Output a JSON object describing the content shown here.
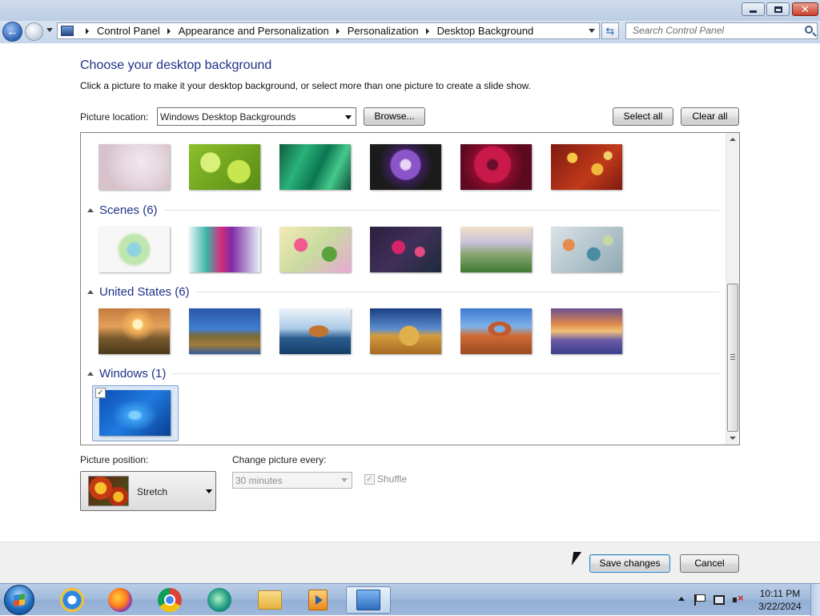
{
  "window": {
    "breadcrumb": [
      "Control Panel",
      "Appearance and Personalization",
      "Personalization",
      "Desktop Background"
    ],
    "search_placeholder": "Search Control Panel",
    "title_icons": {
      "minimize": "minimize-icon",
      "maximize": "restore-icon",
      "close": "close-icon"
    }
  },
  "page": {
    "heading": "Choose your desktop background",
    "subheading": "Click a picture to make it your desktop background, or select more than one picture to create a slide show."
  },
  "toolbar": {
    "location_label": "Picture location:",
    "location_value": "Windows Desktop Backgrounds",
    "browse_label": "Browse...",
    "select_all_label": "Select all",
    "clear_all_label": "Clear all"
  },
  "gallery": {
    "groups": [
      {
        "title": "Scenes (6)"
      },
      {
        "title": "United States (6)"
      },
      {
        "title": "Windows (1)"
      }
    ],
    "selected_item_checked": "✓"
  },
  "options": {
    "position_label": "Picture position:",
    "position_value": "Stretch",
    "change_label": "Change picture every:",
    "change_value": "30 minutes",
    "shuffle_label": "Shuffle",
    "shuffle_checked": "✓"
  },
  "footer": {
    "save_label": "Save changes",
    "cancel_label": "Cancel"
  },
  "taskbar": {
    "apps": [
      "internet-explorer-icon",
      "firefox-icon",
      "chrome-icon",
      "edge-icon",
      "file-explorer-icon",
      "media-player-icon",
      "control-panel-icon"
    ],
    "time": "10:11 PM",
    "date": "3/22/2024"
  }
}
